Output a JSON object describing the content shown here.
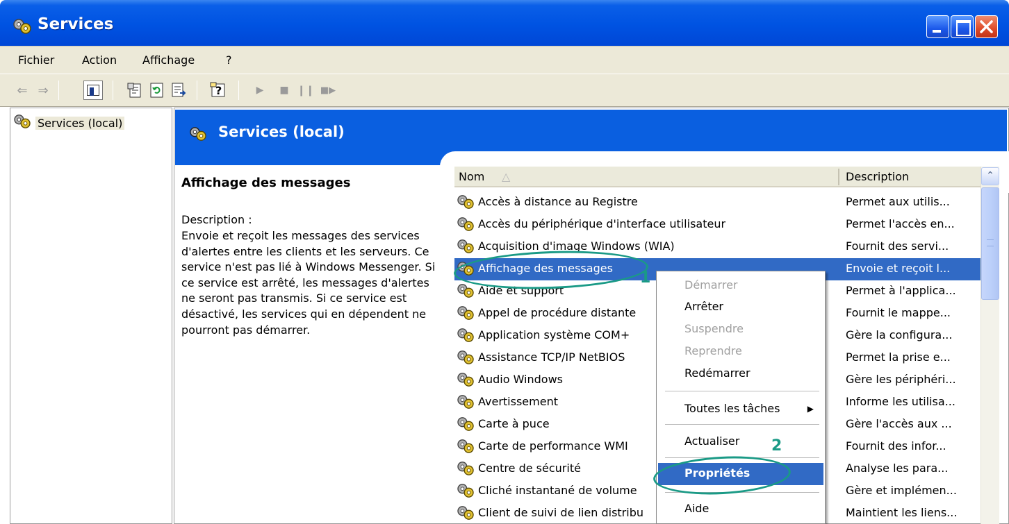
{
  "window": {
    "title": "Services",
    "accent_color": "#0a5fe0",
    "selection_color": "#316ac5",
    "annotation_color": "#1a9a86"
  },
  "menubar": {
    "items": [
      "Fichier",
      "Action",
      "Affichage",
      "?"
    ]
  },
  "toolbar": {
    "icons": [
      "back-arrow-icon",
      "forward-arrow-icon",
      "show-hide-tree-icon",
      "properties-icon",
      "refresh-icon",
      "export-list-icon",
      "help-icon",
      "play-icon",
      "stop-icon",
      "pause-icon",
      "restart-icon"
    ]
  },
  "tree": {
    "root_label": "Services (local)"
  },
  "header": {
    "title": "Services (local)"
  },
  "details": {
    "title": "Affichage des messages",
    "description_label": "Description :",
    "description_text": "Envoie et reçoit les messages des services d'alertes entre les clients et les serveurs. Ce service n'est pas lié à Windows Messenger. Si ce service est arrêté, les messages d'alertes ne seront pas transmis. Si ce service est désactivé, les services qui en dépendent ne pourront pas démarrer."
  },
  "list": {
    "columns": {
      "name": "Nom",
      "sort_indicator": "^",
      "description": "Description"
    },
    "rows": [
      {
        "name": "Accès à distance au Registre",
        "description": "Permet aux utilis..."
      },
      {
        "name": "Accès du périphérique d'interface utilisateur",
        "description": "Permet l'accès en..."
      },
      {
        "name": "Acquisition d'image Windows (WIA)",
        "description": "Fournit des servi..."
      },
      {
        "name": "Affichage des messages",
        "description": "Envoie et reçoit l..."
      },
      {
        "name": "Aide et support",
        "description": "Permet à l'applica..."
      },
      {
        "name": "Appel de procédure distante",
        "description": "Fournit le mappe..."
      },
      {
        "name": "Application système COM+",
        "description": "Gère la configura..."
      },
      {
        "name": "Assistance TCP/IP NetBIOS",
        "description": "Permet la prise e..."
      },
      {
        "name": "Audio Windows",
        "description": "Gère les périphéri..."
      },
      {
        "name": "Avertissement",
        "description": "Informe les utilisa..."
      },
      {
        "name": "Carte à puce",
        "description": "Gère l'accès aux ..."
      },
      {
        "name": "Carte de performance WMI",
        "description": "Fournit des infor..."
      },
      {
        "name": "Centre de sécurité",
        "description": "Analyse les para..."
      },
      {
        "name": "Cliché instantané de volume",
        "description": "Gère et implémen..."
      },
      {
        "name": "Client de suivi de lien distribu",
        "description": "Maintient les liens..."
      }
    ],
    "selected_index": 3
  },
  "context_menu": {
    "start": "Démarrer",
    "stop": "Arrêter",
    "pause": "Suspendre",
    "resume": "Reprendre",
    "restart": "Redémarrer",
    "all_tasks": "Toutes les tâches",
    "refresh": "Actualiser",
    "properties": "Propriétés",
    "help": "Aide"
  },
  "annotations": {
    "step1": "1",
    "step2": "2"
  }
}
